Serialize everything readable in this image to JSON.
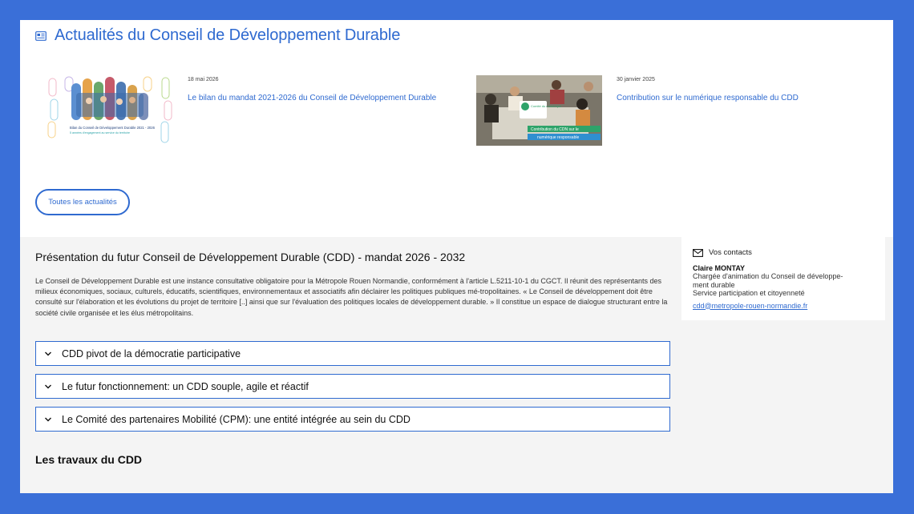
{
  "news": {
    "title": "Actualités du Conseil de Développement Durable",
    "items": [
      {
        "date": "18 mai 2026",
        "title": "Le bilan du mandat 2021-2026 du Conseil de Développement Durable",
        "thumb_caption_1": "Bilan du Conseil de Développement Durable 2021 - 2026",
        "thumb_caption_2": "5 années d'engagement au service du territoire"
      },
      {
        "date": "30 janvier 2025",
        "title": "Contribution sur le numérique responsable du CDD",
        "thumb_badge": "Comité du numérique",
        "thumb_caption_1": "Contribution du CDN sur le",
        "thumb_caption_2": "numérique responsable"
      }
    ],
    "all_button": "Toutes les actualités"
  },
  "presentation": {
    "title": "Présentation du futur Conseil de Développement Durable (CDD) - mandat 2026 - 2032",
    "paragraph": "Le Conseil de Développement Durable est une instance consultative obligatoire pour la Métropole Rouen Normandie, conformément à l'article L.5211-10-1 du CGCT. Il réunit des représentants des milieux économiques, sociaux, culturels, éducatifs, scientifiques, environnementaux et associatifs afin déclairer les politiques publiques mé-tropolitaines.    « Le Conseil de développement doit être consulté sur l'élaboration et les évolutions du projet de territoire [..] ainsi que sur l'évaluation des politiques locales de développement durable. » Il constitue un espace de dialogue structurant entre la société civile organisée et les élus métropolitains."
  },
  "accordions": [
    {
      "label": "CDD pivot de la démocratie participative"
    },
    {
      "label": "Le futur fonctionnement: un CDD souple, agile et réactif"
    },
    {
      "label": "Le Comité des partenaires Mobilité (CPM): une entité intégrée au sein du CDD"
    }
  ],
  "travaux_title": "Les travaux du CDD",
  "contacts": {
    "heading": "Vos contacts",
    "name": "Claire MONTAY",
    "role_1": "Chargée d'animation du Conseil de développe-",
    "role_2": "ment durable",
    "service": "Service participation et citoyenneté",
    "email": "cdd@metropole-rouen-normandie.fr"
  },
  "colors": {
    "accent": "#2f6ad0",
    "frame": "#3a6fd8",
    "grey_bg": "#f4f4f4"
  },
  "icons": {
    "news": "newspaper-icon",
    "chevron": "chevron-down-icon",
    "mail": "mail-icon"
  }
}
